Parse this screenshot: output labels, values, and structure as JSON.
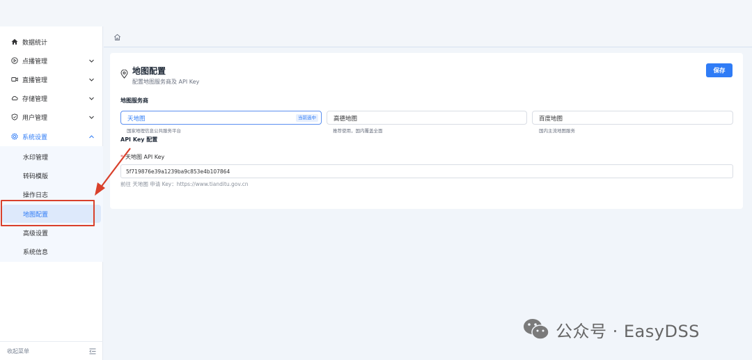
{
  "sidebar": {
    "items": [
      {
        "label": "数据统计",
        "icon": "home-icon",
        "has_chevron": false
      },
      {
        "label": "点播管理",
        "icon": "play-circle-icon",
        "has_chevron": true
      },
      {
        "label": "直播管理",
        "icon": "video-camera-icon",
        "has_chevron": true
      },
      {
        "label": "存储管理",
        "icon": "cloud-icon",
        "has_chevron": true
      },
      {
        "label": "用户管理",
        "icon": "shield-icon",
        "has_chevron": true
      },
      {
        "label": "系统设置",
        "icon": "gear-icon",
        "has_chevron": true,
        "expanded": true,
        "active": true
      }
    ],
    "subitems": [
      {
        "label": "水印管理"
      },
      {
        "label": "转码模版"
      },
      {
        "label": "操作日志"
      },
      {
        "label": "地图配置",
        "selected": true
      },
      {
        "label": "高级设置"
      },
      {
        "label": "系统信息"
      }
    ],
    "footer_label": "收起菜单"
  },
  "card": {
    "title": "地图配置",
    "subtitle": "配置地图服务商及 API Key",
    "save_label": "保存"
  },
  "providers_section_label": "地图服务商",
  "providers": [
    {
      "name": "天地图",
      "desc": "国家地理信息公共服务平台",
      "selected": true,
      "badge": "当前选中"
    },
    {
      "name": "高德地图",
      "desc": "推荐使用，国内覆盖全面",
      "selected": false
    },
    {
      "name": "百度地图",
      "desc": "国内主流地图服务",
      "selected": false
    }
  ],
  "apikey_section_label": "API Key 配置",
  "apikey": {
    "required_mark": "*",
    "label": "天地图 API Key",
    "value": "5f719876e39a1239ba9c853e4b107864",
    "hint": "前往 天地图 申请 Key：https://www.tianditu.gov.cn"
  },
  "watermark_text": "公众号 · EasyDSS",
  "colors": {
    "accent": "#2f7cf6",
    "annotation_red": "#d9402b"
  }
}
